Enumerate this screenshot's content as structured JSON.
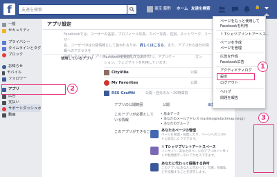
{
  "topbar": {
    "logo": "f",
    "search_placeholder": "友達を検索",
    "profile_name": "東京 藤野",
    "nav_home": "ホーム",
    "nav_find_friends": "友達を検索",
    "lock_label": "🔒"
  },
  "sidebar": {
    "items": [
      {
        "label": "一般",
        "color": "#8d949e"
      },
      {
        "label": "セキュリティ",
        "color": "#f0b429"
      },
      {
        "label": "プライバシー",
        "color": "#5b7bd5"
      },
      {
        "label": "タイムラインとタグ付け",
        "color": "#5b7bd5"
      },
      {
        "label": "ブロック",
        "color": "#e23b3b"
      },
      {
        "label": "お知らせ",
        "color": "#3b5998"
      },
      {
        "label": "モバイル",
        "color": "#4b4f56"
      },
      {
        "label": "フォロワー",
        "color": "#3b5998"
      },
      {
        "label": "アプリ",
        "color": "#3b5998"
      },
      {
        "label": "広告",
        "color": "#4b4f56"
      },
      {
        "label": "支払い",
        "color": "#4b4f56"
      },
      {
        "label": "サポートダッシュボード",
        "color": "#e23b3b"
      },
      {
        "label": "動画",
        "color": "#4b4f56"
      }
    ]
  },
  "main": {
    "title": "アプリ設定",
    "description_line1": "Facebookでは、ユーザーの名前、プロフィール写真、カバー写真、性別、ネットワーク、ユーザー",
    "description_line2": "名、ユーザーIDは公開情報として扱われるため、",
    "description_link": "詳しくはこちら",
    "description_line3": "。また、アプリから自分の情報へのアクセスを",
    "description_line4": "許可しなくても、アプリはこれらの情報を表示できます。",
    "used_apps_label": "使用しているアプリ",
    "used_apps_text1": "Facebookを使用して次のアプリ、アプリケー",
    "used_apps_text2": "ション、ウェブサイトを利用しています:",
    "used_apps_toggle": "オン",
    "apps": [
      {
        "name": "CityVille",
        "visibility": "公開",
        "color": "#8d6e63"
      },
      {
        "name": "My Favorites",
        "visibility": "公開",
        "color": "#d0342c"
      },
      {
        "name": "RSS Graffiti",
        "visibility": "公開",
        "color": "#3b5998"
      }
    ],
    "rss_meta": "公開・自分のみ・20時間前",
    "app_privacy_label": "アプリの公開範囲",
    "app_privacy_value": "公開",
    "app_privacy_edit": "編集",
    "required_label1": "このアプリが必要として",
    "required_label2": "いる情報",
    "required_item1": "• 基本データ",
    "required_item2": "• あなたのメールアドレス (sachiko@lotachmap.ne.jp)",
    "required_item3": "• あなたのグループ",
    "can_do_label": "このアプリができること",
    "permissions": [
      {
        "title": "あなたのページの管理",
        "desc": "ページを管理・投稿したり、ページへのコメントに返信したりできます。",
        "color": "#4267b2"
      },
      {
        "title": "↑ Tシャツプリントアートスペース",
        "desc": "インサイト: あなたのページのアプリのインサイトや利用者データにアクセスできます。",
        "color": "#7b68b5"
      },
      {
        "title": "あなたに代わって投稿する許可",
        "desc": "このアプリはあなたに代わって、写真、投稿などを投稿することを許可します。",
        "color": "#3b5998"
      }
    ]
  },
  "dropdown": {
    "items": [
      "ページをもっと使用して",
      "Facebookを利用",
      "↑ Tシャツプリントアートス…",
      "ページを作成",
      "ページを管理",
      "広告を作成",
      "Facebook広告",
      "アクティビティログ",
      "設定",
      "ログアウト",
      "ヘルプ",
      "問題を報告"
    ]
  },
  "annotations": {
    "n1": "1",
    "n2": "2",
    "n3": "3",
    "color": "#e8317b"
  }
}
